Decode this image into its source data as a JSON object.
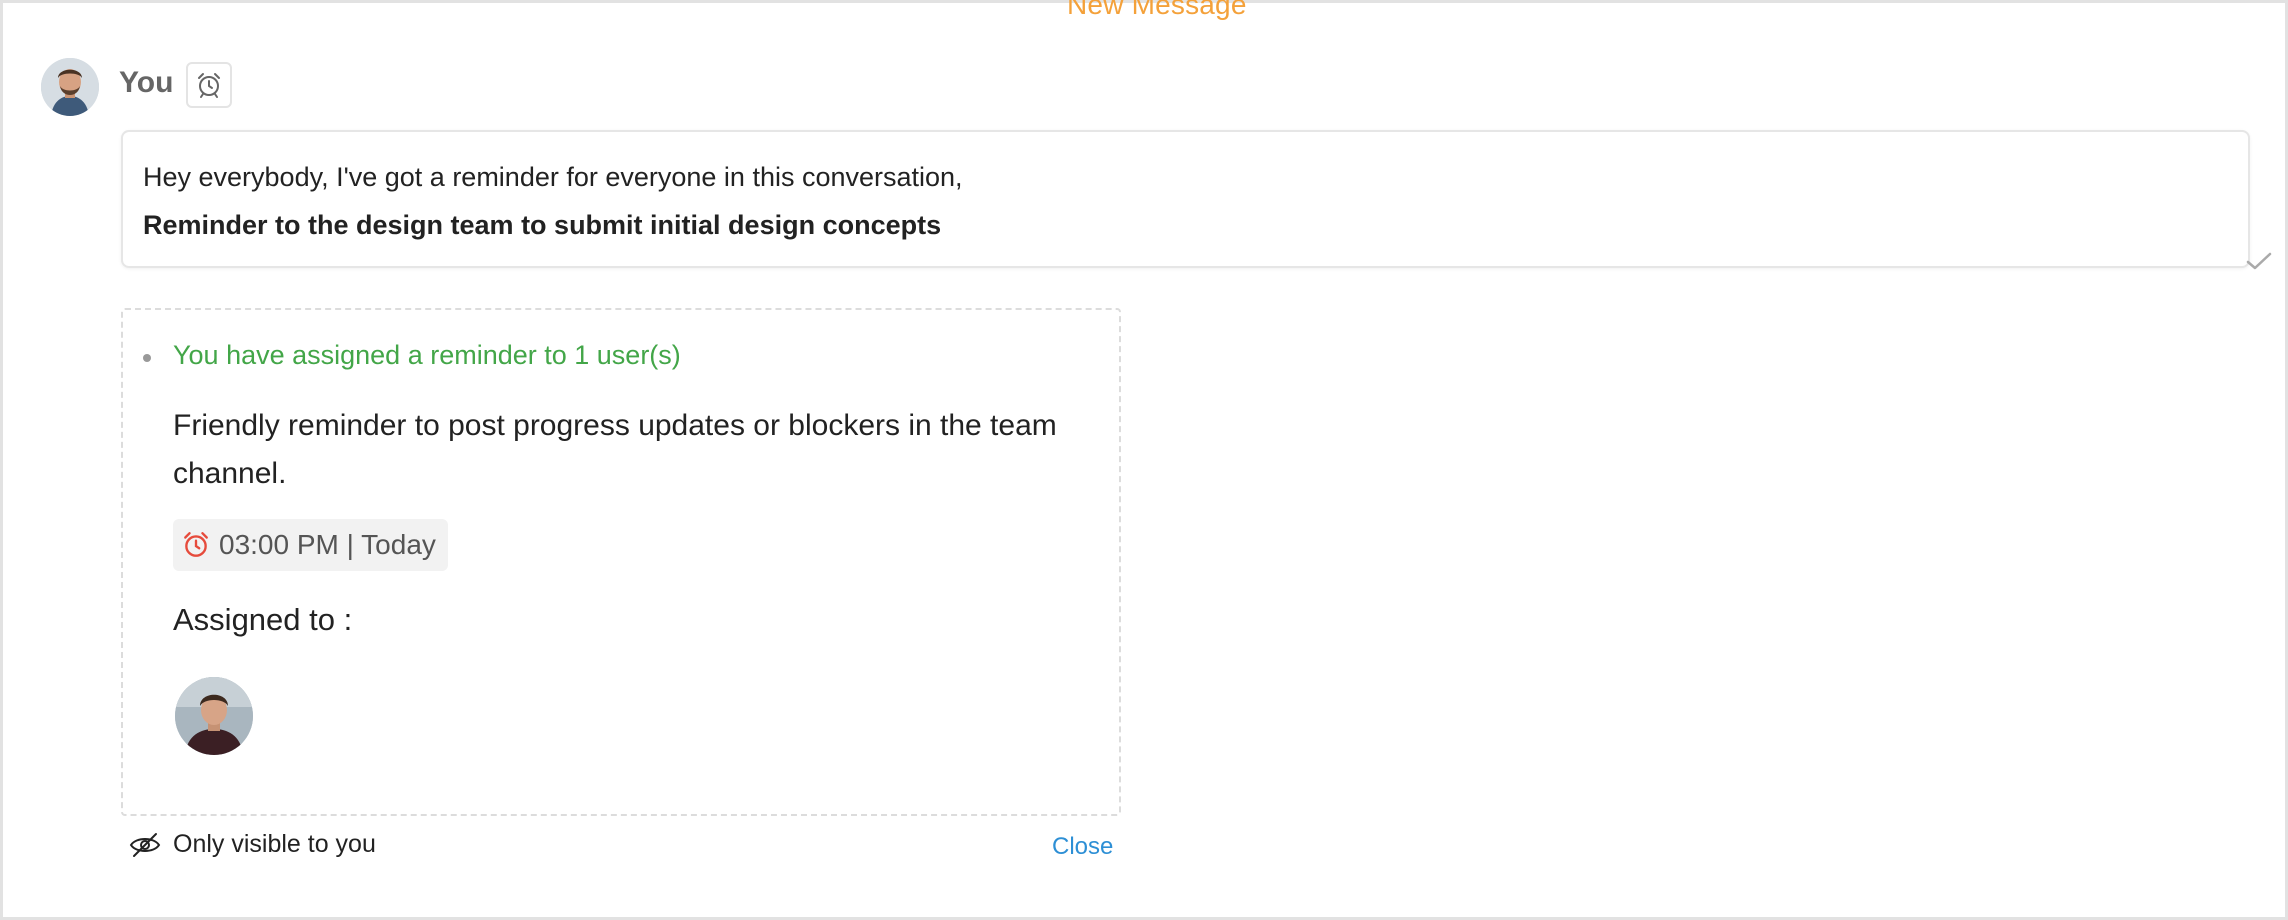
{
  "banner": {
    "new_message": "New Message"
  },
  "message": {
    "sender": "You",
    "line1": "Hey everybody, I've got a reminder for everyone in this conversation,",
    "line2": "Reminder to the design team to submit initial design concepts"
  },
  "reminder": {
    "assigned_text": "You have assigned a reminder to 1 user(s)",
    "description": "Friendly reminder to post progress updates or blockers in the team channel.",
    "time": "03:00 PM | Today",
    "assigned_to_label": "Assigned to :"
  },
  "footer": {
    "visibility_text": "Only visible to you",
    "close_label": "Close"
  },
  "icons": {
    "alarm": "alarm-clock-icon",
    "time": "alarm-clock-icon",
    "visibility": "eye-off-icon",
    "status": "check-icon"
  },
  "colors": {
    "accent_orange": "#f4a13a",
    "success_green": "#43a648",
    "link_blue": "#2d8fd5",
    "alarm_red": "#e64b3c"
  }
}
